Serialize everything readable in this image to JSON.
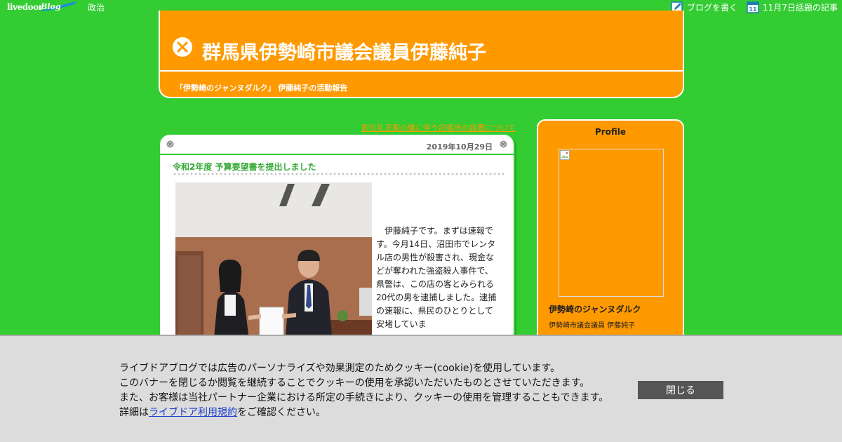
{
  "topbar": {
    "logo_text": "livedoor",
    "logo_blog_text": "Blog",
    "category": "政治",
    "write_blog": "ブログを書く",
    "calendar_day": "11",
    "topic_articles": "11月7日話題の記事"
  },
  "header": {
    "title": "群馬県伊勢崎市議会議員伊藤純子",
    "subtitle": "「伊勢崎のジャンヌダルク」 伊藤純子の活動報告"
  },
  "navigation": {
    "next_article": "即位礼正殿の儀に伴う記帳所の設置について"
  },
  "article": {
    "date": "2019年10月29日",
    "title": "令和2年度 予算要望書を提出しました",
    "body": "　伊藤純子です。まずは速報です。今月14日、沼田市でレンタル店の男性が殺害され、現金などが奪われた強盗殺人事件で、県警は、この店の客とみられる20代の男を逮捕しました。逮捕の速報に、県民のひとりとして安堵していま"
  },
  "sidebar": {
    "profile_heading": "Profile",
    "profile_name": "伊勢崎のジャンヌダルク",
    "profile_description": "伊勢崎市議会議員 伊藤純子"
  },
  "cookie_banner": {
    "line1": "ライブドアブログでは広告のパーソナライズや効果測定のためクッキー(cookie)を使用しています。",
    "line2": "このバナーを閉じるか閲覧を継続することでクッキーの使用を承認いただいたものとさせていただきます。",
    "line3": "また、お客様は当社パートナー企業における所定の手続きにより、クッキーの使用を管理することもできます。",
    "line4_prefix": "詳細は",
    "line4_link": "ライブドア利用規約",
    "line4_suffix": "をご確認ください。",
    "close_label": "閉じる"
  },
  "colors": {
    "background": "#33cc33",
    "header": "#ff9900",
    "link": "#1a3ccc",
    "close_button": "#555555",
    "banner": "#dcdcdc"
  }
}
